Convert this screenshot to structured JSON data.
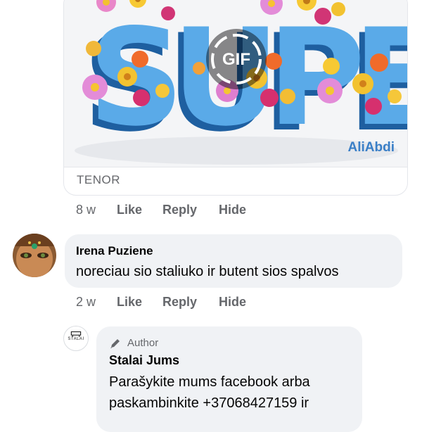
{
  "gif": {
    "badge": "GIF",
    "source": "TENOR",
    "watermark": "AliAbdi",
    "big_word": "SUPER"
  },
  "gif_comment_actions": {
    "time": "8 w",
    "like": "Like",
    "reply": "Reply",
    "hide": "Hide"
  },
  "comment": {
    "author": "Irena Puziene",
    "text": "noreciau sio staliuko ir butent sios spalvos",
    "actions": {
      "time": "2 w",
      "like": "Like",
      "reply": "Reply",
      "hide": "Hide"
    }
  },
  "reply": {
    "badge": "Author",
    "author": "Stalai Jums",
    "avatar_text": "STALAI",
    "lines": [
      "Parašykite mums facebook arba",
      "paskambinkite +37068427159 ir"
    ]
  },
  "colors": {
    "bubble": "#f0f2f5",
    "secondary_text": "#65676b",
    "gif_blue": "#4a9be0"
  }
}
